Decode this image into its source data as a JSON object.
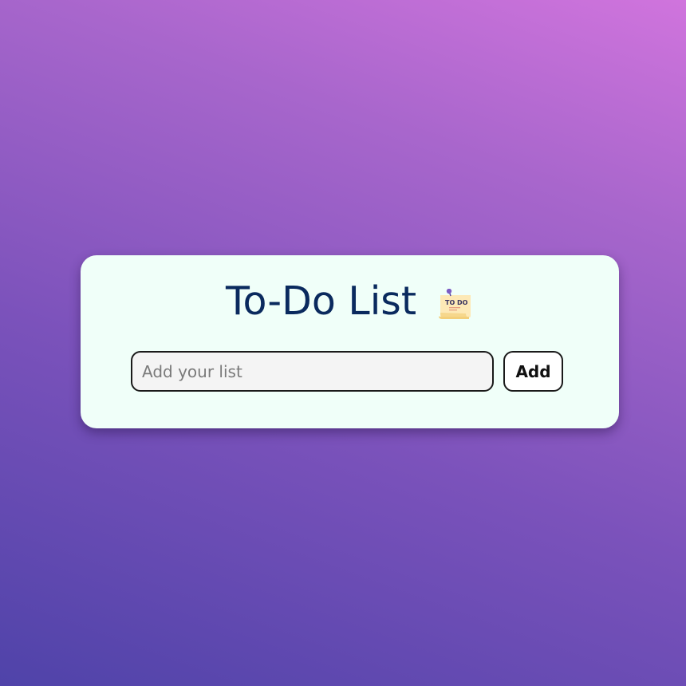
{
  "app": {
    "title": "To-Do List",
    "icon": "todo-note-icon",
    "icon_label": "TO DO"
  },
  "form": {
    "input_value": "",
    "input_placeholder": "Add your list",
    "add_label": "Add"
  },
  "colors": {
    "background_gradient_start": "#4f43a9",
    "background_gradient_end": "#d074dd",
    "card_background": "#f0fff9",
    "title_color": "#0a2a5e",
    "input_background": "#f4f4f4",
    "border_color": "#1a1a1a"
  }
}
